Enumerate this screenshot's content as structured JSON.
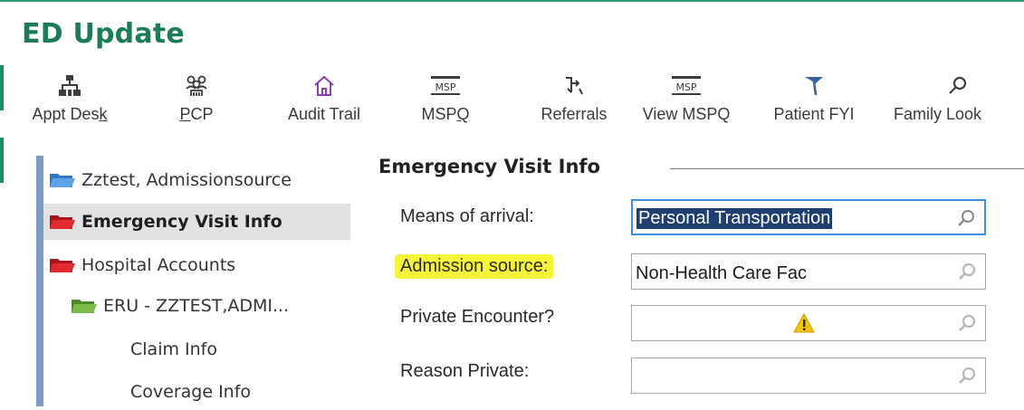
{
  "window": {
    "title": "ED Update"
  },
  "toolbar": {
    "items": [
      {
        "label_pre": "Appt Des",
        "label_u": "k",
        "label_post": "",
        "icon": "org-chart-icon"
      },
      {
        "label_pre": "",
        "label_u": "P",
        "label_post": "CP",
        "icon": "people-icon"
      },
      {
        "label_pre": "Audit Trail",
        "label_u": "",
        "label_post": "",
        "icon": "house-icon"
      },
      {
        "label_pre": "MSP",
        "label_u": "Q",
        "label_post": "",
        "icon": "msp-icon"
      },
      {
        "label_pre": "Referrals",
        "label_u": "",
        "label_post": "",
        "icon": "referral-arrow-icon"
      },
      {
        "label_pre": "View MSPQ",
        "label_u": "",
        "label_post": "",
        "icon": "msp-icon"
      },
      {
        "label_pre": "Patient FYI",
        "label_u": "",
        "label_post": "",
        "icon": "flag-icon"
      },
      {
        "label_pre": "Family Look",
        "label_u": "",
        "label_post": "",
        "icon": "search-icon"
      }
    ],
    "msp_icon_text": "MSP"
  },
  "sidebar": {
    "items": [
      {
        "label": "Zztest, Admissionsource",
        "icon": "blue-folder-icon",
        "selected": false
      },
      {
        "label": "Emergency Visit Info",
        "icon": "red-folder-icon",
        "selected": true
      },
      {
        "label": "Hospital Accounts",
        "icon": "red-folder-icon",
        "selected": false
      },
      {
        "label": "ERU - ZZTEST,ADMI...",
        "icon": "green-folder-icon",
        "selected": false
      },
      {
        "label": "Claim Info",
        "icon": "",
        "selected": false
      },
      {
        "label": "Coverage Info",
        "icon": "",
        "selected": false
      }
    ]
  },
  "section": {
    "title": "Emergency Visit Info",
    "fields": [
      {
        "label": "Means of arrival:",
        "value": "Personal Transportation",
        "highlighted_label": false,
        "active": true
      },
      {
        "label": "Admission source:",
        "value": "Non-Health Care Fac",
        "highlighted_label": true,
        "active": false
      },
      {
        "label": "Private Encounter?",
        "value": "",
        "warning": true,
        "highlighted_label": false,
        "active": false
      },
      {
        "label": "Reason Private:",
        "value": "",
        "highlighted_label": false,
        "active": false
      }
    ]
  },
  "colors": {
    "title_green": "#1c7c56",
    "selection_navy": "#1e3f70",
    "highlight_yellow": "#f7f53a",
    "focus_blue": "#3b8fe6",
    "sidebar_rail": "#7d9cc2"
  }
}
